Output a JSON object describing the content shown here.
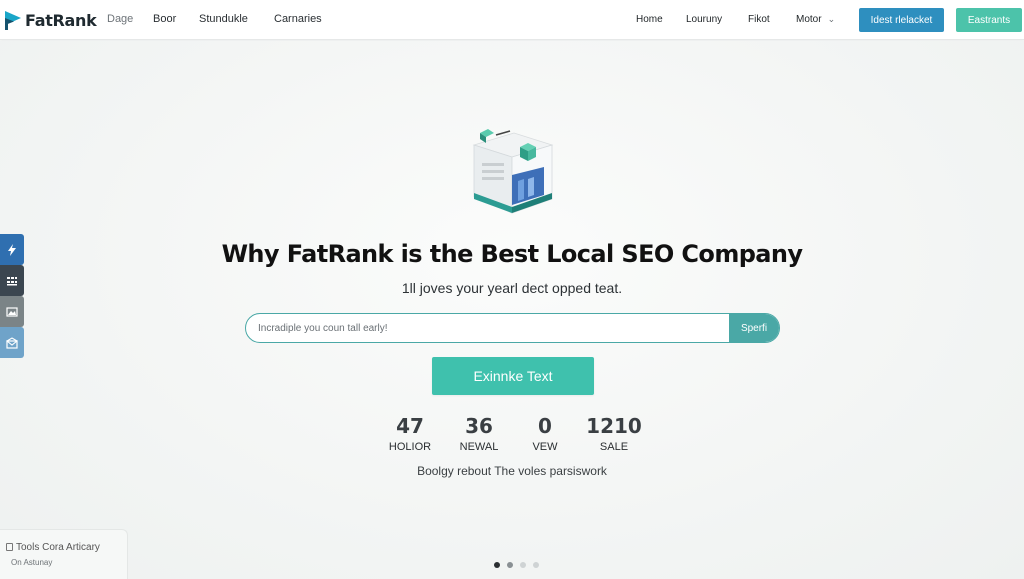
{
  "header": {
    "logo_text": "FatRank",
    "nav_left": [
      "Dage",
      "Boor",
      "Stundukle",
      "Carnaries"
    ],
    "nav_right": [
      "Home",
      "Louruny",
      "Fikot",
      "Motor"
    ],
    "cta_primary": "Idest rlelacket",
    "cta_secondary": "Eastrants"
  },
  "hero": {
    "title": "Why FatRank is the Best Local SEO Company",
    "subtitle": "1ll joves your yearl dect opped teat.",
    "search": {
      "placeholder": "Incradiple you coun tall early!",
      "button": "Sperfi"
    },
    "cta": "Exinnke Text",
    "stats": [
      {
        "value": "47",
        "label": "HOLIOR"
      },
      {
        "value": "36",
        "label": "NEWAL"
      },
      {
        "value": "0",
        "label": "VEW"
      },
      {
        "value": "1210",
        "label": "SALE"
      }
    ],
    "tagline": "Boolgy rebout The voles parsiswork"
  },
  "side_tabs": [
    {
      "icon": "lightning-icon",
      "color": "#2f6fb0"
    },
    {
      "icon": "grid-icon",
      "color": "#3b4650"
    },
    {
      "icon": "image-icon",
      "color": "#7b8487"
    },
    {
      "icon": "mail-icon",
      "color": "#6fa3c9"
    }
  ],
  "footer": {
    "title": "Tools Cora Articary",
    "subtitle": "On Astunay"
  },
  "carousel": {
    "total": 4,
    "active": 1
  },
  "colors": {
    "brand_blue": "#2e8fbf",
    "brand_teal": "#4cc3aa",
    "search_teal": "#4aa8a6",
    "cta_teal": "#3fc1ad"
  }
}
